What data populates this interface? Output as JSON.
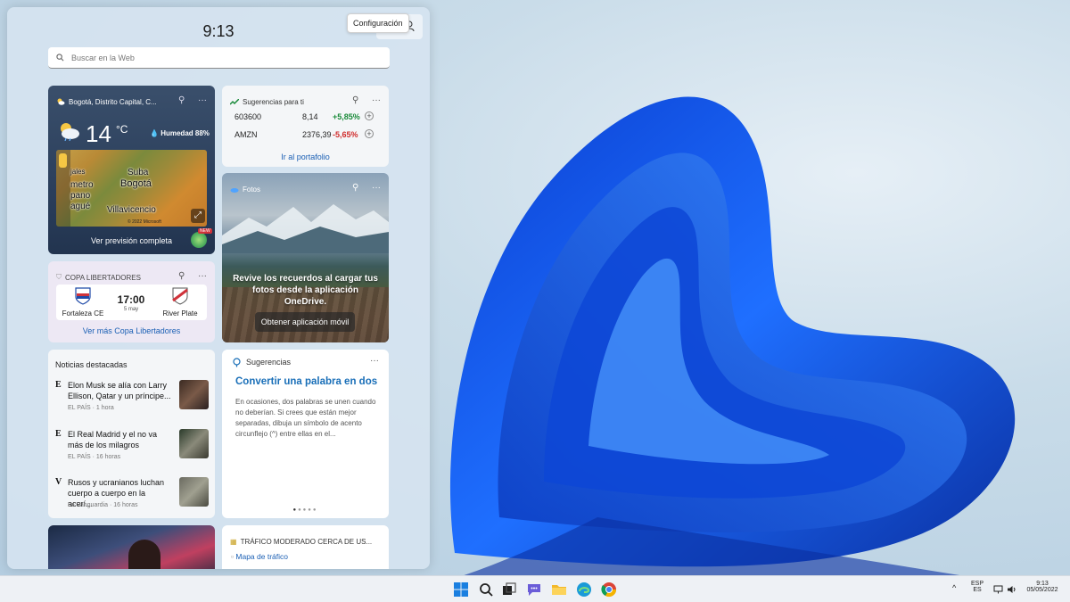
{
  "panel": {
    "time": "9:13",
    "settings_tooltip": "Configuración",
    "search_placeholder": "Buscar en la Web"
  },
  "weather": {
    "location": "Bogotá, Distrito Capital, C...",
    "temperature": "14",
    "unit": "°C",
    "humidity": "Humedad 88%",
    "map_labels": [
      "Suba",
      "Bogotá",
      "Villavicencio",
      "metro",
      "pano",
      "agué",
      "jales"
    ],
    "map_credit": "© 2022 Microsoft",
    "forecast_link": "Ver previsión completa",
    "badge": "NEW"
  },
  "stocks": {
    "title": "Sugerencias para ti",
    "rows": [
      {
        "symbol": "603600",
        "price": "8,14",
        "change": "+5,85%",
        "color": "#1a8a3a"
      },
      {
        "symbol": "AMZN",
        "price": "2376,39",
        "change": "-5,65%",
        "color": "#d02c2c"
      }
    ],
    "link": "Ir al portafolio"
  },
  "photos": {
    "title": "Fotos",
    "message": "Revive los recuerdos al cargar tus fotos desde la aplicación OneDrive.",
    "button": "Obtener aplicación móvil"
  },
  "copa": {
    "title": "COPA LIBERTADORES",
    "home": "Fortaleza CE",
    "away": "River Plate",
    "time": "17:00",
    "date": "5 may",
    "link": "Ver más Copa Libertadores"
  },
  "news": {
    "title": "Noticias destacadas",
    "items": [
      {
        "icon": "E",
        "headline": "Elon Musk se alía con Larry Ellison, Qatar y un príncipe...",
        "meta": "EL PAÍS · 1 hora"
      },
      {
        "icon": "E",
        "headline": "El Real Madrid y el no va más de los milagros",
        "meta": "EL PAÍS · 16 horas"
      },
      {
        "icon": "V",
        "headline": "Rusos y ucranianos luchan cuerpo a cuerpo en la acerí...",
        "meta": "La Vanguardia · 16 horas"
      }
    ]
  },
  "suggestions": {
    "title": "Sugerencias",
    "headline": "Convertir una palabra en dos",
    "body": "En ocasiones, dos palabras se unen cuando no deberían. Si crees que están mejor separadas, dibuja un símbolo de acento circunflejo (^) entre ellas en el..."
  },
  "traffic": {
    "title": "TRÁFICO MODERADO CERCA DE US...",
    "map_alt": "Mapa de tráfico"
  },
  "taskbar": {
    "lang_top": "ESP",
    "lang_bottom": "ES",
    "clock": "9:13",
    "date": "05/05/2022",
    "chevron": "^"
  },
  "colors": {
    "accent": "#1a6fb8",
    "positive": "#1a8a3a",
    "negative": "#d02c2c"
  }
}
